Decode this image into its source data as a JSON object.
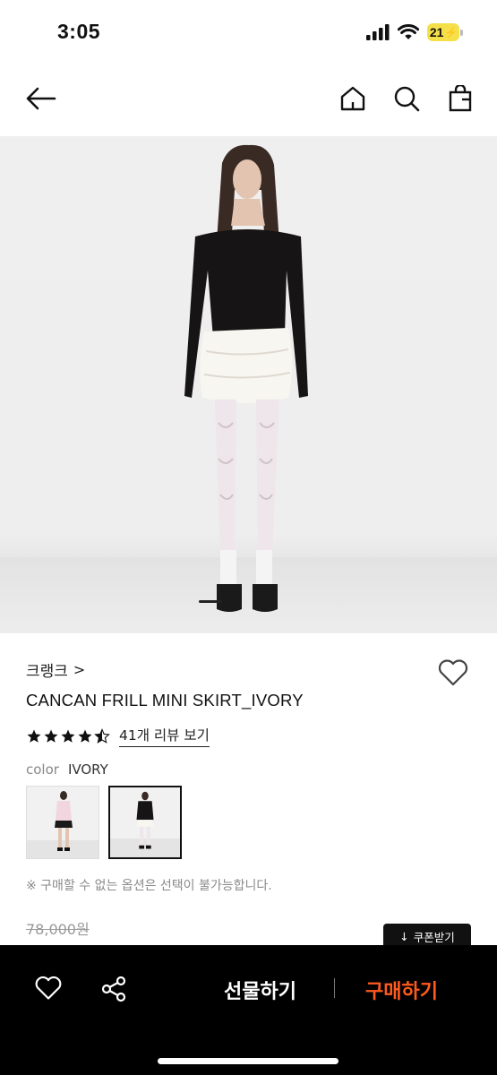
{
  "status_bar": {
    "time": "3:05",
    "battery": "21",
    "icons": [
      "signal-icon",
      "wifi-icon",
      "battery-icon"
    ]
  },
  "nav": {
    "icons": [
      "back-arrow-icon",
      "home-icon",
      "search-icon",
      "shopping-bag-icon"
    ]
  },
  "product": {
    "brand": "크랭크",
    "brand_chevron": ">",
    "title": "CANCAN FRILL MINI SKIRT_IVORY",
    "rating": 4.5,
    "review_link": "41개 리뷰 보기",
    "color_label": "color",
    "color_value": "IVORY",
    "option_note": "※ 구매할 수 없는 옵션은 선택이 불가능합니다.",
    "original_price": "78,000원",
    "coupon_button": "쿠폰받기"
  },
  "bottom_bar": {
    "gift_label": "선물하기",
    "buy_label": "구매하기",
    "icons": [
      "heart-icon",
      "share-icon"
    ]
  },
  "colors": {
    "accent": "#ff5a1f",
    "battery": "#f6e04a",
    "bottom_bar": "#000000"
  }
}
